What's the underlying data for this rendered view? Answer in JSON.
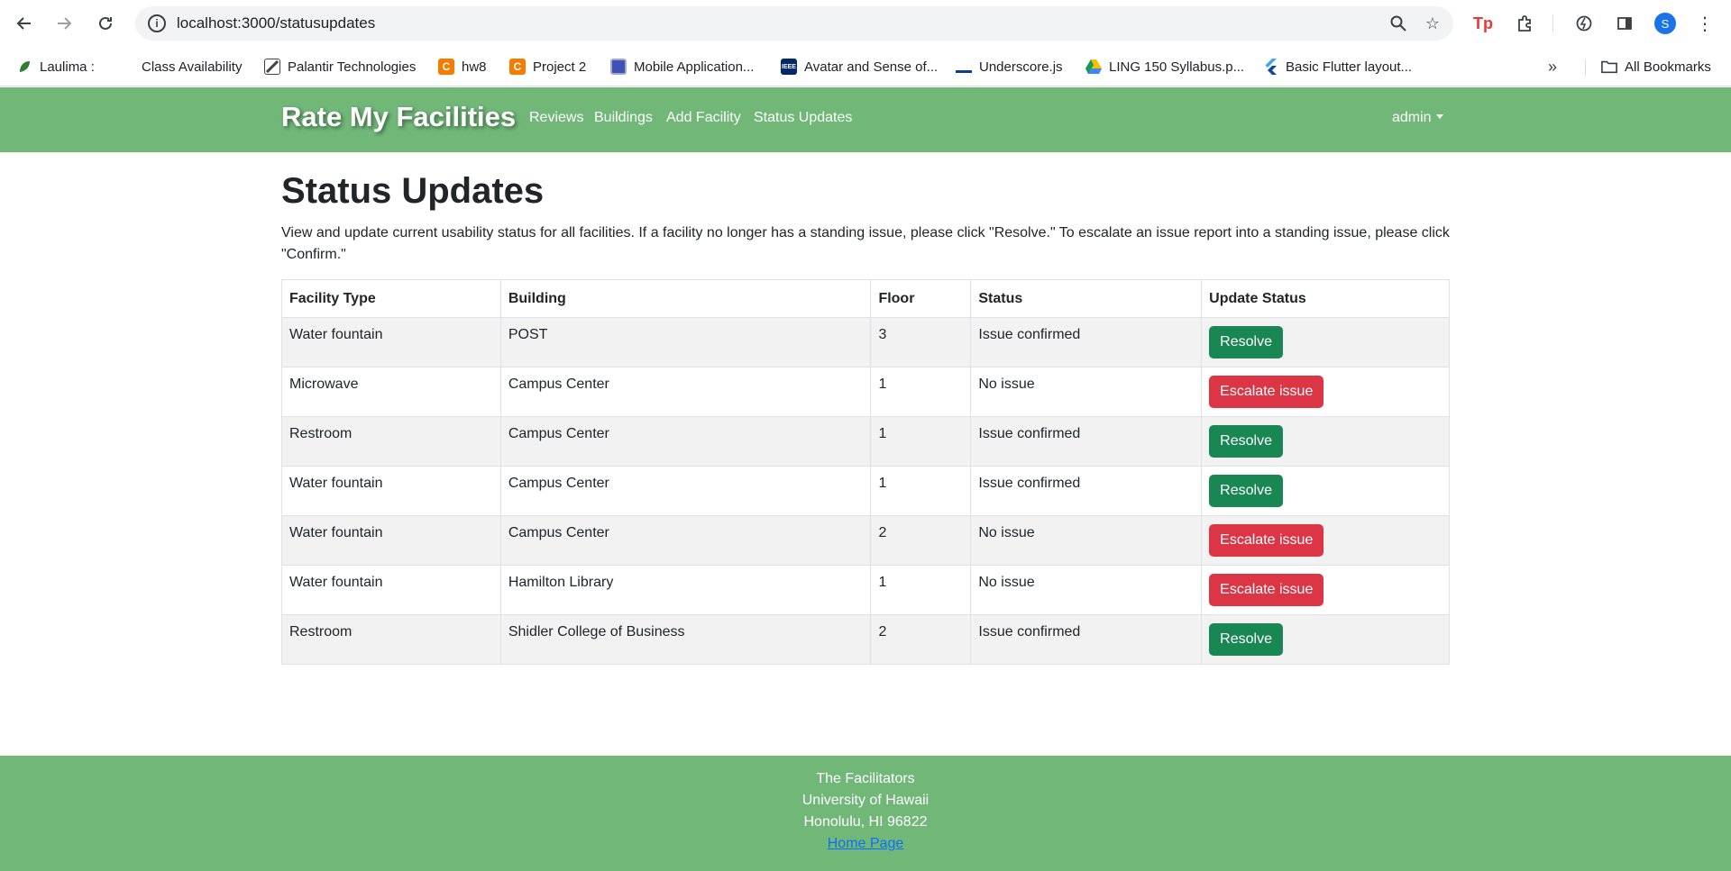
{
  "browser": {
    "url": "localhost:3000/statusupdates",
    "profile_initial": "S",
    "bookmarks": [
      {
        "label": "Laulima :",
        "icon": "leaf-icon",
        "color": "#2e7d32"
      },
      {
        "label": "Class Availability",
        "icon": "",
        "color": ""
      },
      {
        "label": "Palantir Technologies",
        "icon": "palantir-icon",
        "color": "#444444"
      },
      {
        "label": "hw8",
        "icon": "c-icon",
        "color": "#f57c00"
      },
      {
        "label": "Project 2",
        "icon": "c-icon",
        "color": "#f57c00"
      },
      {
        "label": "Mobile Application...",
        "icon": "page-icon",
        "color": "#3f51b5"
      },
      {
        "label": "Avatar and Sense of...",
        "icon": "ieee-icon",
        "color": "#00296b"
      },
      {
        "label": "Underscore.js",
        "icon": "underscore-icon",
        "color": "#0b3d91"
      },
      {
        "label": "LING 150 Syllabus.p...",
        "icon": "drive-icon",
        "color": "#fbbc04"
      },
      {
        "label": "Basic Flutter layout...",
        "icon": "flutter-icon",
        "color": "#42a5f5"
      }
    ],
    "all_bookmarks_label": "All Bookmarks"
  },
  "navbar": {
    "brand": "Rate My Facilities",
    "links": [
      "Reviews",
      "Buildings",
      "Add Facility",
      "Status Updates"
    ],
    "user": "admin"
  },
  "main": {
    "title": "Status Updates",
    "description": "View and update current usability status for all facilities. If a facility no longer has a standing issue, please click \"Resolve.\" To escalate an issue report into a standing issue, please click \"Confirm.\"",
    "table": {
      "headers": [
        "Facility Type",
        "Building",
        "Floor",
        "Status",
        "Update Status"
      ],
      "rows": [
        {
          "type": "Water fountain",
          "building": "POST",
          "floor": "3",
          "status": "Issue confirmed",
          "action": "Resolve"
        },
        {
          "type": "Microwave",
          "building": "Campus Center",
          "floor": "1",
          "status": "No issue",
          "action": "Escalate issue"
        },
        {
          "type": "Restroom",
          "building": "Campus Center",
          "floor": "1",
          "status": "Issue confirmed",
          "action": "Resolve"
        },
        {
          "type": "Water fountain",
          "building": "Campus Center",
          "floor": "1",
          "status": "Issue confirmed",
          "action": "Resolve"
        },
        {
          "type": "Water fountain",
          "building": "Campus Center",
          "floor": "2",
          "status": "No issue",
          "action": "Escalate issue"
        },
        {
          "type": "Water fountain",
          "building": "Hamilton Library",
          "floor": "1",
          "status": "No issue",
          "action": "Escalate issue"
        },
        {
          "type": "Restroom",
          "building": "Shidler College of Business",
          "floor": "2",
          "status": "Issue confirmed",
          "action": "Resolve"
        }
      ]
    }
  },
  "footer": {
    "lines": [
      "The Facilitators",
      "University of Hawaii",
      "Honolulu, HI 96822"
    ],
    "link": "Home Page"
  },
  "colors": {
    "nav_green": "#70b778",
    "resolve": "#198754",
    "escalate": "#dc3545"
  }
}
